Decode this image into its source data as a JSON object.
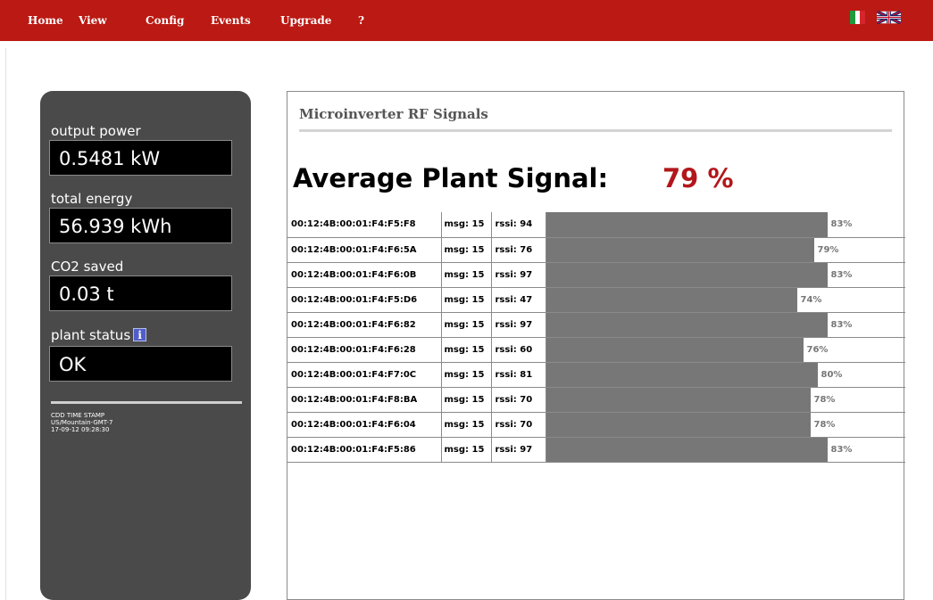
{
  "nav": {
    "items": [
      "Home",
      "View",
      "Config",
      "Events",
      "Upgrade",
      "?"
    ]
  },
  "colors": {
    "accent": "#bb1913",
    "signal_value": "#b2171b",
    "bar": "#777777",
    "panel": "#4a4a4a"
  },
  "side": {
    "output_power_label": "output power",
    "output_power_value": "0.5481 kW",
    "total_energy_label": "total energy",
    "total_energy_value": "56.939 kWh",
    "co2_label": "CO2 saved",
    "co2_value": "0.03 t",
    "status_label": "plant status",
    "status_icon": "info-icon",
    "status_value": "OK",
    "stamp_line1": "CDD TIME STAMP",
    "stamp_line2": "US/Mountain-GMT-7",
    "stamp_line3": "17-09-12 09:28:30"
  },
  "main": {
    "title": "Microinverter RF Signals",
    "average_label": "Average Plant Signal:",
    "average_value": "79 %",
    "rows": [
      {
        "addr": "00:12:4B:00:01:F4:F5:F8",
        "msg": "msg: 15",
        "rssi": "rssi: 94",
        "pct": "83%",
        "level": 83
      },
      {
        "addr": "00:12:4B:00:01:F4:F6:5A",
        "msg": "msg: 15",
        "rssi": "rssi: 76",
        "pct": "79%",
        "level": 79
      },
      {
        "addr": "00:12:4B:00:01:F4:F6:0B",
        "msg": "msg: 15",
        "rssi": "rssi: 97",
        "pct": "83%",
        "level": 83
      },
      {
        "addr": "00:12:4B:00:01:F4:F5:D6",
        "msg": "msg: 15",
        "rssi": "rssi: 47",
        "pct": "74%",
        "level": 74
      },
      {
        "addr": "00:12:4B:00:01:F4:F6:82",
        "msg": "msg: 15",
        "rssi": "rssi: 97",
        "pct": "83%",
        "level": 83
      },
      {
        "addr": "00:12:4B:00:01:F4:F6:28",
        "msg": "msg: 15",
        "rssi": "rssi: 60",
        "pct": "76%",
        "level": 76
      },
      {
        "addr": "00:12:4B:00:01:F4:F7:0C",
        "msg": "msg: 15",
        "rssi": "rssi: 81",
        "pct": "80%",
        "level": 80
      },
      {
        "addr": "00:12:4B:00:01:F4:F8:BA",
        "msg": "msg: 15",
        "rssi": "rssi: 70",
        "pct": "78%",
        "level": 78
      },
      {
        "addr": "00:12:4B:00:01:F4:F6:04",
        "msg": "msg: 15",
        "rssi": "rssi: 70",
        "pct": "78%",
        "level": 78
      },
      {
        "addr": "00:12:4B:00:01:F4:F5:86",
        "msg": "msg: 15",
        "rssi": "rssi: 97",
        "pct": "83%",
        "level": 83
      }
    ]
  }
}
